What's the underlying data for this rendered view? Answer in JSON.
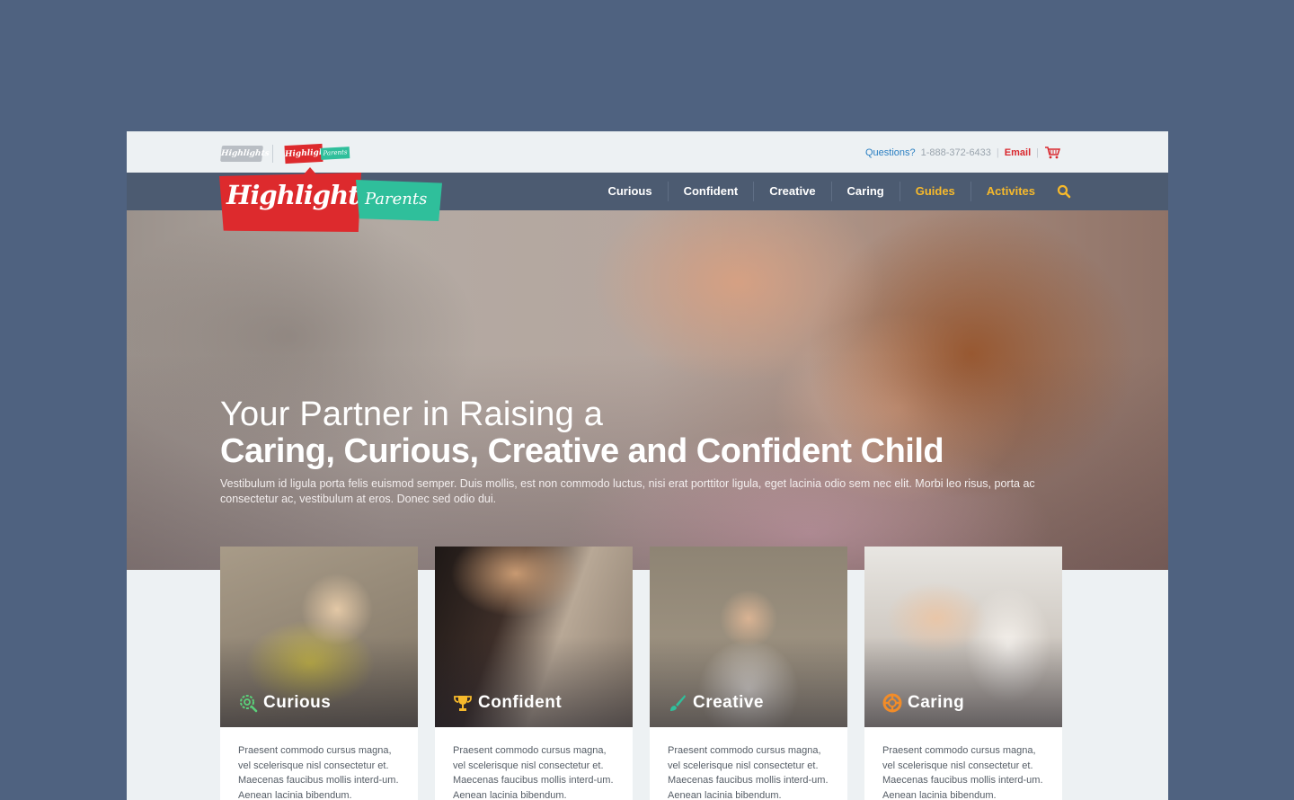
{
  "utility": {
    "brand_small": "Highlights",
    "brand_red": "Highlights",
    "brand_green": "Parents",
    "questions_label": "Questions?",
    "phone": "1-888-372-6433",
    "email_label": "Email"
  },
  "logo": {
    "wordmark": "Highlights",
    "sub": "Parents"
  },
  "nav": {
    "items": [
      {
        "label": "Curious"
      },
      {
        "label": "Confident"
      },
      {
        "label": "Creative"
      },
      {
        "label": "Caring"
      },
      {
        "label": "Guides"
      },
      {
        "label": "Activites"
      }
    ]
  },
  "hero": {
    "line1": "Your Partner in Raising a",
    "line2": "Caring, Curious, Creative and Confident Child",
    "description": "Vestibulum id ligula porta felis euismod semper. Duis mollis, est non commodo luctus, nisi erat porttitor ligula, eget lacinia odio sem nec elit. Morbi leo risus, porta ac consectetur ac, vestibulum at eros. Donec sed odio dui."
  },
  "cards": [
    {
      "title": "Curious",
      "body": "Praesent commodo cursus magna, vel scelerisque nisl consectetur et. Maecenas faucibus mollis interd-um. Aenean lacinia bibendum."
    },
    {
      "title": "Confident",
      "body": "Praesent commodo cursus magna, vel scelerisque nisl consectetur et. Maecenas faucibus mollis interd-um. Aenean lacinia bibendum."
    },
    {
      "title": "Creative",
      "body": "Praesent commodo cursus magna, vel scelerisque nisl consectetur et. Maecenas faucibus mollis interd-um. Aenean lacinia bibendum."
    },
    {
      "title": "Caring",
      "body": "Praesent commodo cursus magna, vel scelerisque nisl consectetur et. Maecenas faucibus mollis interd-um. Aenean lacinia bibendum."
    }
  ],
  "colors": {
    "page_bg": "#4f6280",
    "nav_bg": "#4c5b71",
    "brand_red": "#dd2a2d",
    "brand_green": "#2fbf9b",
    "accent_yellow": "#f6b92b",
    "link_blue": "#2a7fc2"
  },
  "icons": {
    "search": "search-icon",
    "cart": "cart-icon",
    "curious": "magnifier-cloud-icon",
    "confident": "trophy-icon",
    "creative": "paintbrush-icon",
    "caring": "lifebuoy-icon"
  }
}
